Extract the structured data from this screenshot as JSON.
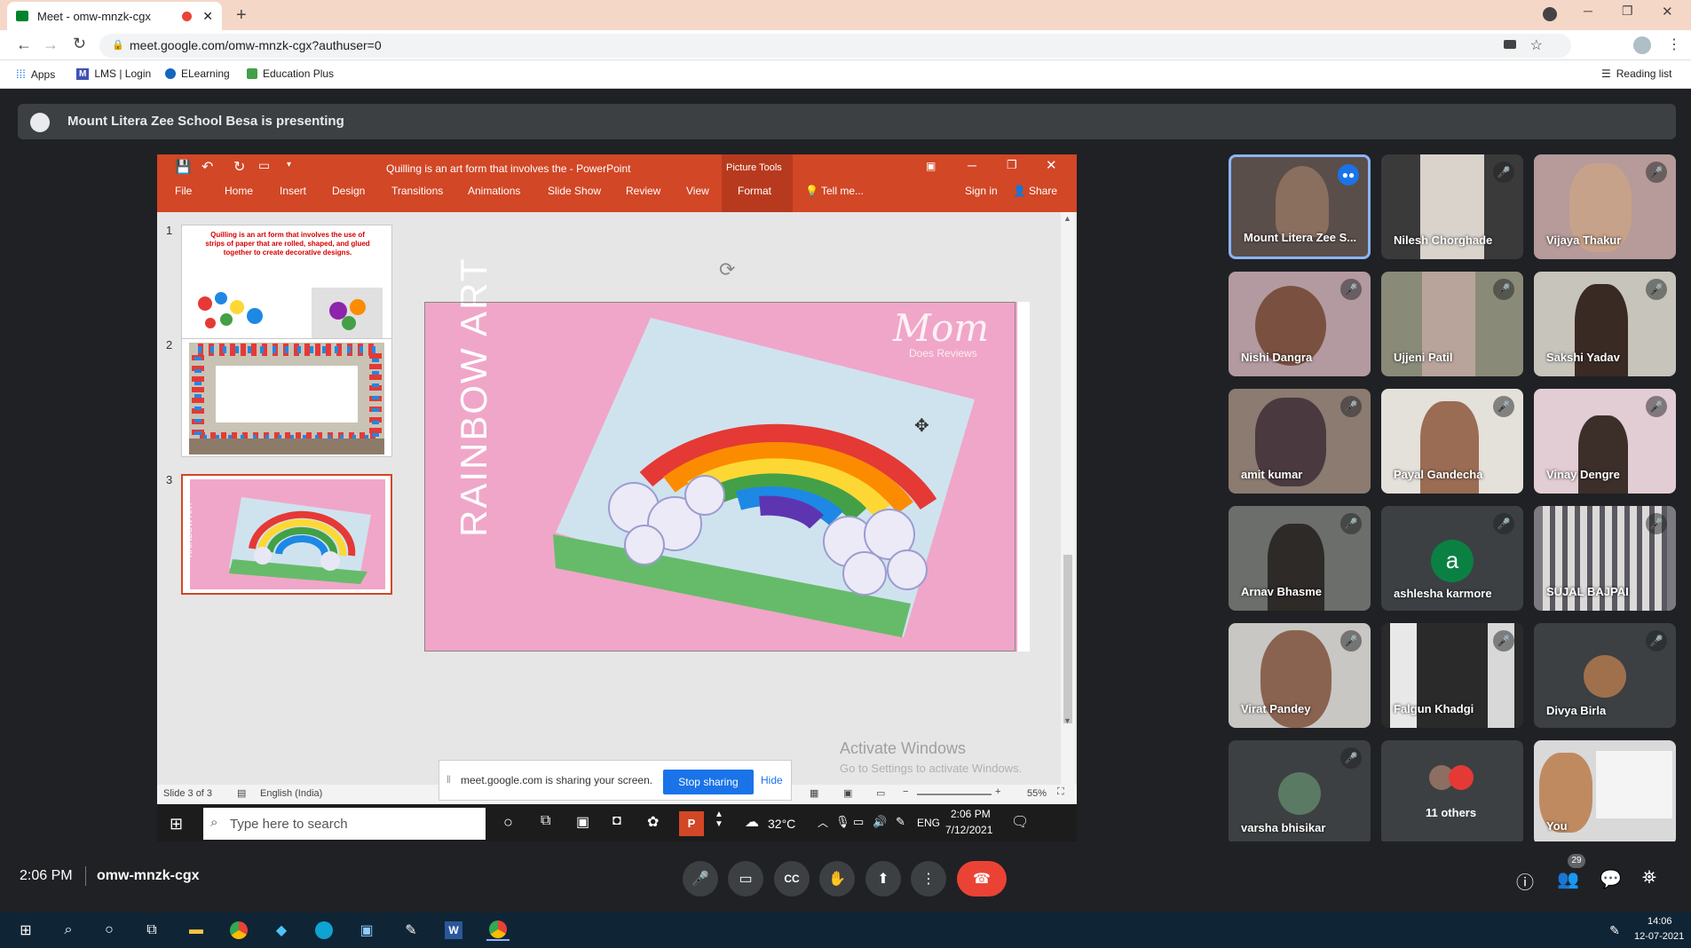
{
  "browser": {
    "tab_title": "Meet - omw-mnzk-cgx",
    "url": "meet.google.com/omw-mnzk-cgx?authuser=0",
    "bookmarks": [
      "Apps",
      "LMS | Login",
      "ELearning",
      "Education Plus"
    ],
    "reading_list": "Reading list"
  },
  "meet": {
    "presenting_text": "Mount Litera Zee School Besa is presenting",
    "time": "2:06 PM",
    "meeting_code": "omw-mnzk-cgx",
    "participant_count": "29",
    "participants": [
      {
        "name": "Mount Litera Zee S...",
        "muted": false,
        "speaking": true
      },
      {
        "name": "Nilesh Chorghade",
        "muted": true
      },
      {
        "name": "Vijaya Thakur",
        "muted": true
      },
      {
        "name": "Nishi Dangra",
        "muted": true
      },
      {
        "name": "Ujjeni Patil",
        "muted": true
      },
      {
        "name": "Sakshi Yadav",
        "muted": true
      },
      {
        "name": "amit kumar",
        "muted": true
      },
      {
        "name": "Payal Gandecha",
        "muted": true
      },
      {
        "name": "Vinay Dengre",
        "muted": true
      },
      {
        "name": "Arnav Bhasme",
        "muted": true
      },
      {
        "name": "ashlesha karmore",
        "muted": true,
        "avatar_letter": "a"
      },
      {
        "name": "SUJAL BAJPAI",
        "muted": true
      },
      {
        "name": "Virat Pandey",
        "muted": true
      },
      {
        "name": "Falgun Khadgi",
        "muted": true
      },
      {
        "name": "Divya Birla",
        "muted": true
      },
      {
        "name": "varsha bhisikar",
        "muted": true
      },
      {
        "name": "11 others",
        "muted": false
      },
      {
        "name": "You",
        "muted": false
      }
    ]
  },
  "ppt": {
    "window_title": "Quilling is an art form that involves the - PowerPoint",
    "picture_tools": "Picture Tools",
    "tabs": [
      "File",
      "Home",
      "Insert",
      "Design",
      "Transitions",
      "Animations",
      "Slide Show",
      "Review",
      "View",
      "Format"
    ],
    "tell_me": "Tell me...",
    "sign_in": "Sign in",
    "share": "Share",
    "slide1_text": "Quilling is an art form that involves the use of strips of paper that are rolled, shaped, and glued together to create decorative designs.",
    "slide_title": "RAINBOW ART",
    "watermark": "Mom",
    "watermark_sub": "Does Reviews",
    "status_slide": "Slide 3 of 3",
    "status_lang": "English (India)",
    "zoom": "55%",
    "activate_title": "Activate Windows",
    "activate_sub": "Go to Settings to activate Windows.",
    "sharing_text": "meet.google.com is sharing your screen.",
    "stop_sharing": "Stop sharing",
    "hide": "Hide",
    "taskbar_search": "Type here to search",
    "weather": "32°C",
    "lang": "ENG",
    "clock_time": "2:06 PM",
    "clock_date": "7/12/2021"
  },
  "windows": {
    "clock_time": "14:06",
    "clock_date": "12-07-2021"
  },
  "colors": {
    "ppt_orange": "#d24726",
    "meet_bg": "#202124",
    "end_call": "#ea4335",
    "slide_pink": "#f0a6c8"
  }
}
